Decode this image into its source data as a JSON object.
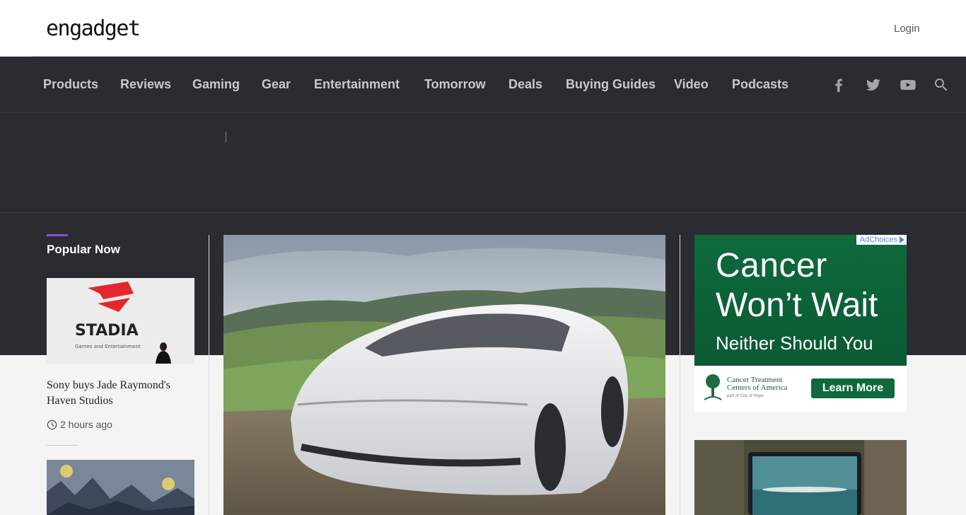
{
  "header": {
    "logo_text": "engadget",
    "login_label": "Login"
  },
  "nav": {
    "items": [
      {
        "label": "Products"
      },
      {
        "label": "Reviews"
      },
      {
        "label": "Gaming"
      },
      {
        "label": "Gear"
      },
      {
        "label": "Entertainment"
      },
      {
        "label": "Tomorrow"
      },
      {
        "label": "Deals"
      },
      {
        "label": "Buying Guides"
      },
      {
        "label": "Video"
      },
      {
        "label": "Podcasts"
      }
    ],
    "icons": [
      "facebook-icon",
      "twitter-icon",
      "youtube-icon",
      "search-icon"
    ]
  },
  "popular": {
    "title": "Popular Now",
    "stories": [
      {
        "thumb_text": "STADIA",
        "thumb_subtext": "Games and Entertainment",
        "title": "Sony buys Jade Raymond's Haven Studios",
        "time": "2 hours ago"
      }
    ]
  },
  "hero": {
    "image": "white-electric-sedan-photo"
  },
  "ad": {
    "adchoices": "AdChoices",
    "line1": "Cancer",
    "line2": "Won’t Wait",
    "line3": "Neither  Should You",
    "org_line1": "Cancer Treatment",
    "org_line2": "Centers of America",
    "org_sub": "part of  City of Hope",
    "cta": "Learn More",
    "brand_color": "#0e6a3c"
  },
  "colors": {
    "accent": "#8c4fd6",
    "dark_band": "#2b2c31",
    "nav_text": "#c9c9cd"
  }
}
